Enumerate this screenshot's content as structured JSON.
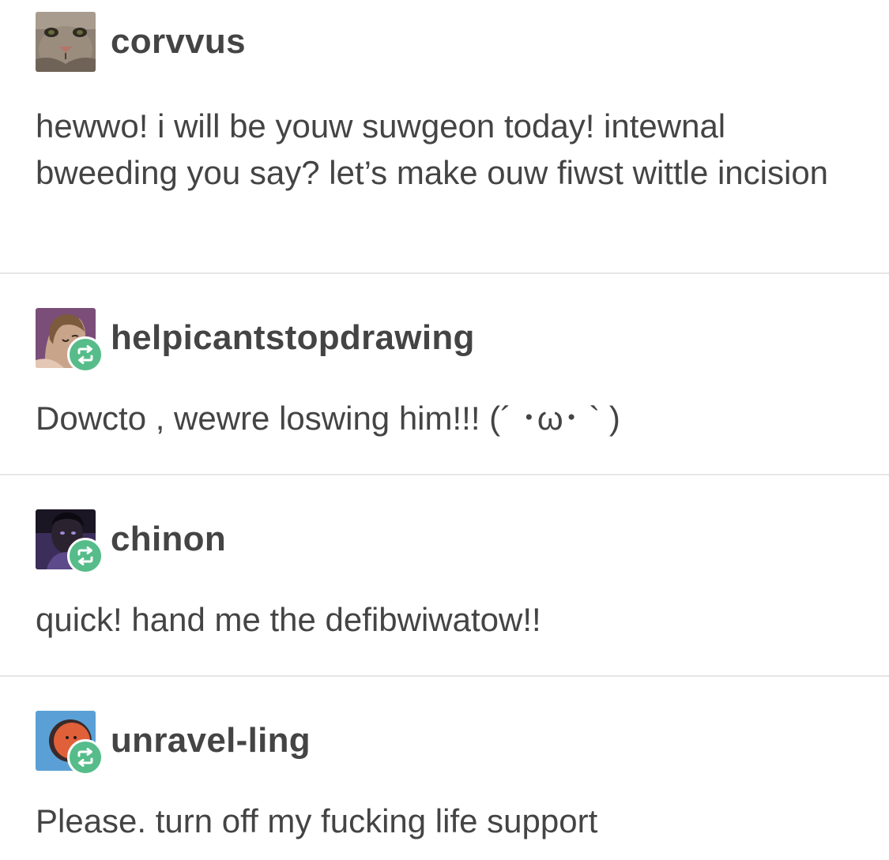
{
  "posts": [
    {
      "username": "corvvus",
      "avatar_icon": "cat-avatar-icon",
      "reblog": false,
      "text": "hewwo! i will be youw suwgeon today! intewnal bweeding you say? let’s make ouw fiwst wittle incision"
    },
    {
      "username": "helpicantstopdrawing",
      "avatar_icon": "drawn-portrait-avatar-icon",
      "reblog": true,
      "text": "Dowcto , wewre loswing him!!! (´ ･ω･ ` )"
    },
    {
      "username": "chinon",
      "avatar_icon": "dark-portrait-avatar-icon",
      "reblog": true,
      "text": "quick! hand me the defibwiwatow!!"
    },
    {
      "username": "unravel-ling",
      "avatar_icon": "orange-circle-avatar-icon",
      "reblog": true,
      "text": "Please. turn off my fucking life support"
    }
  ],
  "colors": {
    "text": "#444444",
    "divider": "#e6e6e6",
    "reblog_badge": "#56bc8a",
    "background": "#ffffff"
  }
}
